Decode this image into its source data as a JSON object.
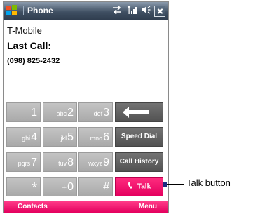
{
  "titlebar": {
    "title": "Phone"
  },
  "call_info": {
    "carrier": "T-Mobile",
    "last_call_label": "Last Call:",
    "last_number": "(098) 825-2432"
  },
  "keypad": {
    "k1": {
      "digit": "1",
      "letters": ""
    },
    "k2": {
      "digit": "2",
      "letters": "abc"
    },
    "k3": {
      "digit": "3",
      "letters": "def"
    },
    "k4": {
      "digit": "4",
      "letters": "ghi"
    },
    "k5": {
      "digit": "5",
      "letters": "jkl"
    },
    "k6": {
      "digit": "6",
      "letters": "mno"
    },
    "k7": {
      "digit": "7",
      "letters": "pqrs"
    },
    "k8": {
      "digit": "8",
      "letters": "tuv"
    },
    "k9": {
      "digit": "9",
      "letters": "wxyz"
    },
    "star": "*",
    "k0": {
      "digit": "0",
      "letters": "+"
    },
    "hash": "#"
  },
  "functions": {
    "speed_dial": "Speed Dial",
    "call_history": "Call History",
    "talk": "Talk"
  },
  "softkeys": {
    "left": "Contacts",
    "right": "Menu"
  },
  "annotation": {
    "talk_label": "Talk button"
  },
  "icons": {
    "start": "windows-flag-icon",
    "connectivity": "sync-arrows-icon",
    "signal": "signal-strength-icon",
    "volume": "speaker-icon",
    "close": "close-icon",
    "backspace": "left-arrow-icon",
    "talk": "phone-handset-icon"
  },
  "colors": {
    "accent": "#e8006a",
    "titlebar": "#3f4f62"
  }
}
